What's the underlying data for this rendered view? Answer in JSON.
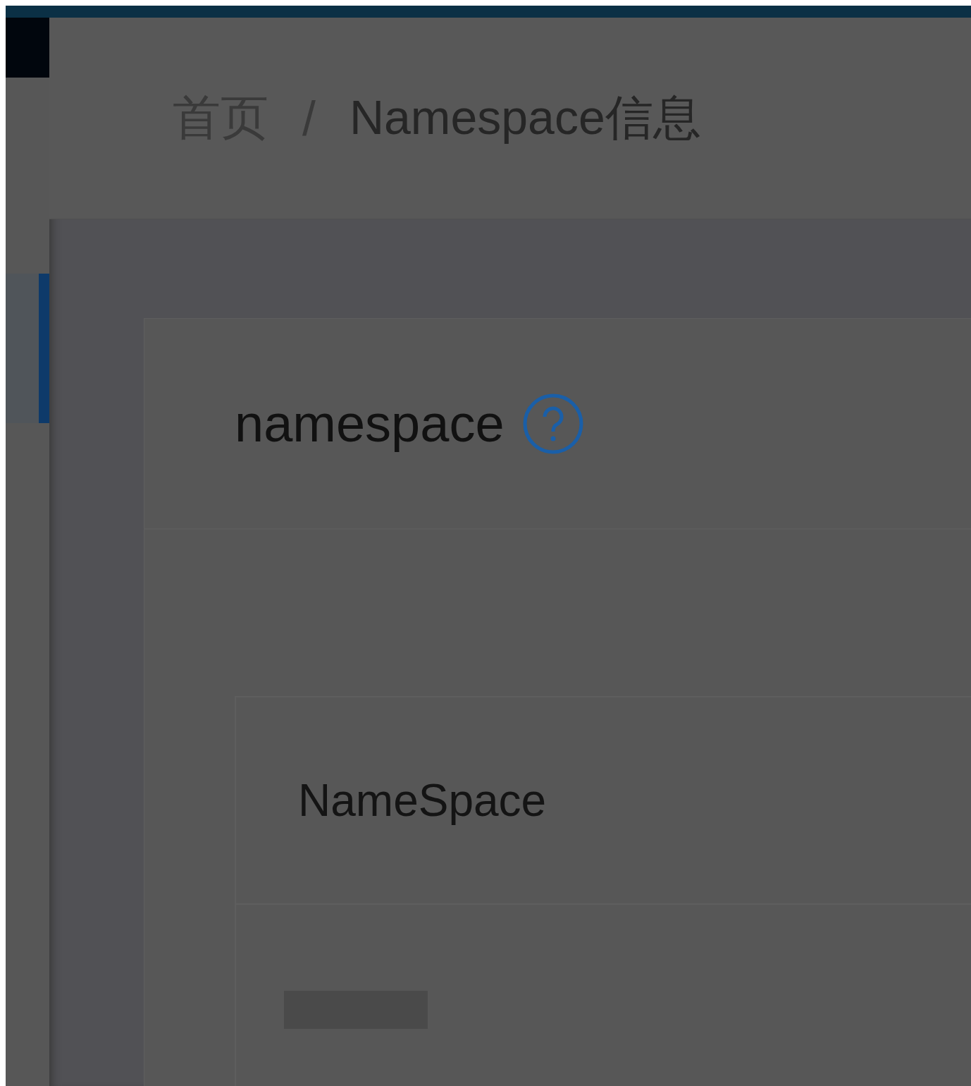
{
  "breadcrumb": [
    {
      "label": "首页",
      "selected": false
    },
    {
      "label": "Namespace信息",
      "selected": true
    }
  ],
  "breadcrumb_separator": "/",
  "sidebar": {
    "items": [
      {
        "selected": true
      }
    ]
  },
  "card": {
    "title": "namespace"
  },
  "table": {
    "columns": [
      "NameSpace"
    ]
  }
}
